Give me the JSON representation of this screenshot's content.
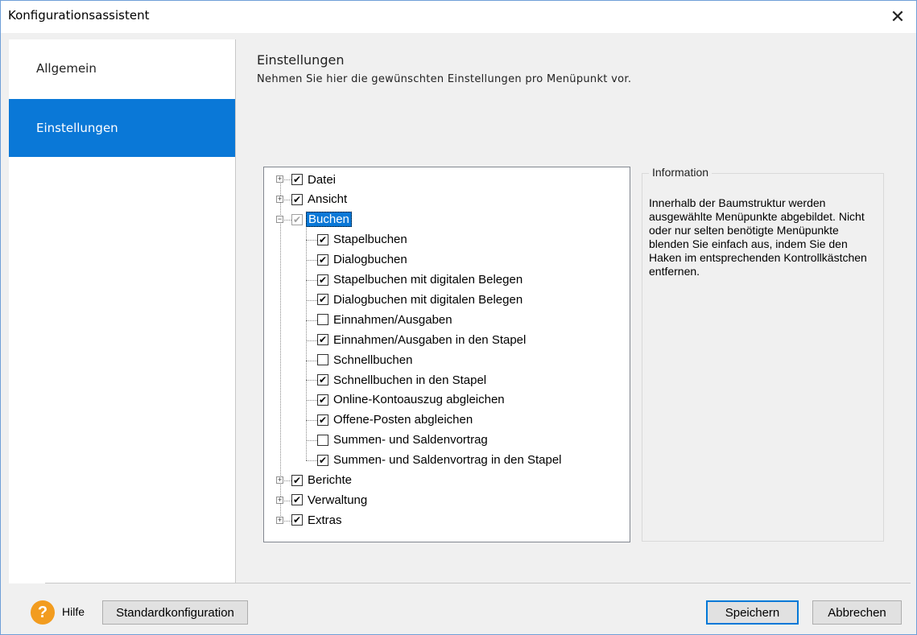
{
  "window": {
    "title": "Konfigurationsassistent",
    "close": "✕"
  },
  "sidebar": {
    "items": [
      {
        "label": "Allgemein",
        "active": false
      },
      {
        "label": "Einstellungen",
        "active": true
      }
    ]
  },
  "content": {
    "title": "Einstellungen",
    "subtitle": "Nehmen Sie hier die gewünschten Einstellungen pro Menüpunkt vor."
  },
  "tree": {
    "nodes": [
      {
        "label": "Datei",
        "checked": true,
        "expanded": false
      },
      {
        "label": "Ansicht",
        "checked": true,
        "expanded": false
      },
      {
        "label": "Buchen",
        "checked": true,
        "expanded": true,
        "selected": true,
        "indeterminate": true
      },
      {
        "label": "Stapelbuchen",
        "checked": true,
        "child": true
      },
      {
        "label": "Dialogbuchen",
        "checked": true,
        "child": true
      },
      {
        "label": "Stapelbuchen mit digitalen Belegen",
        "checked": true,
        "child": true
      },
      {
        "label": "Dialogbuchen mit digitalen Belegen",
        "checked": true,
        "child": true
      },
      {
        "label": "Einnahmen/Ausgaben",
        "checked": false,
        "child": true
      },
      {
        "label": "Einnahmen/Ausgaben in den Stapel",
        "checked": true,
        "child": true
      },
      {
        "label": "Schnellbuchen",
        "checked": false,
        "child": true
      },
      {
        "label": "Schnellbuchen in den Stapel",
        "checked": true,
        "child": true
      },
      {
        "label": "Online-Kontoauszug abgleichen",
        "checked": true,
        "child": true
      },
      {
        "label": "Offene-Posten abgleichen",
        "checked": true,
        "child": true
      },
      {
        "label": "Summen- und Saldenvortrag",
        "checked": false,
        "child": true
      },
      {
        "label": "Summen- und Saldenvortrag in den Stapel",
        "checked": true,
        "child": true
      },
      {
        "label": "Berichte",
        "checked": true,
        "expanded": false
      },
      {
        "label": "Verwaltung",
        "checked": true,
        "expanded": false
      },
      {
        "label": "Extras",
        "checked": true,
        "expanded": false
      }
    ]
  },
  "info": {
    "legend": "Information",
    "text": "Innerhalb der Baumstruktur werden ausgewählte Menüpunkte abgebildet. Nicht oder nur selten benötigte Menüpunkte blenden Sie einfach aus, indem Sie den Haken im entsprechenden Kontrollkästchen entfernen."
  },
  "footer": {
    "help_icon": "?",
    "help_label": "Hilfe",
    "standard_button": "Standardkonfiguration",
    "save_button": "Speichern",
    "cancel_button": "Abbrechen"
  },
  "colors": {
    "accent": "#0a78d7",
    "help": "#f29c1f"
  }
}
